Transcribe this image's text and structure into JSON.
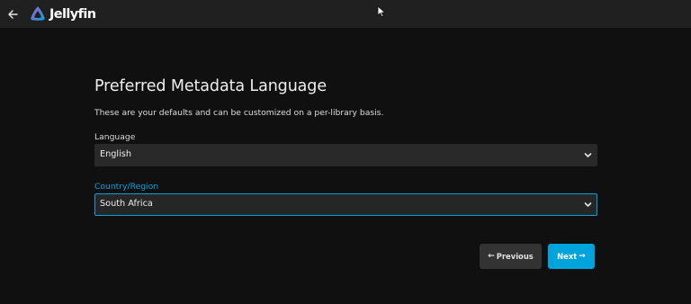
{
  "header": {
    "app_name": "Jellyfin",
    "back_icon": "back-arrow-icon",
    "logo_icon": "jellyfin-logo-icon"
  },
  "wizard": {
    "title": "Preferred Metadata Language",
    "description": "These are your defaults and can be customized on a per-library basis.",
    "language": {
      "label": "Language",
      "value": "English"
    },
    "country": {
      "label": "Country/Region",
      "value": "South Africa"
    },
    "buttons": {
      "previous_arrow": "←",
      "previous_label": "Previous",
      "next_label": "Next",
      "next_arrow": "→"
    }
  },
  "colors": {
    "accent": "#00a4dc",
    "background": "#101010",
    "topbar": "#202020",
    "input": "#292929",
    "secondary_button": "#333333"
  }
}
